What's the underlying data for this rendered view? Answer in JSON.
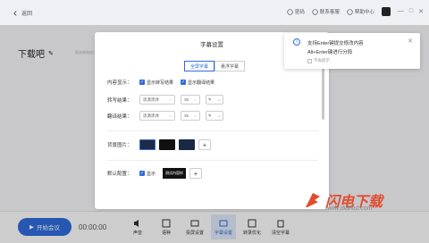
{
  "header": {
    "back_label": "返回",
    "items": [
      {
        "label": "密码",
        "icon": "lock-icon"
      },
      {
        "label": "联系客服",
        "icon": "headset-icon"
      },
      {
        "label": "帮助中心",
        "icon": "help-icon"
      }
    ]
  },
  "main": {
    "title": "下载吧",
    "subtitle": "双击修改会议名称"
  },
  "dialog": {
    "title": "字幕设置",
    "tabs": [
      "全屏字幕",
      "悬浮字幕"
    ],
    "content_label": "内容显示：",
    "show_transcript": "显示转写结果",
    "show_translation": "显示翻译结果",
    "transcript_label": "转写结果：",
    "translation_label": "翻译结果：",
    "font": "思源黑体",
    "size": "35",
    "bg_label": "背景图片：",
    "default_label": "默认配置：",
    "show": "显示",
    "preview_text": "测试内容样"
  },
  "toast": {
    "line1": "支持Enter键提交修改内容",
    "line2": "Alt+Enter键进行分段",
    "checkbox": "不再提示"
  },
  "bottom": {
    "start": "开始会议",
    "timer": "00:00:00",
    "tools": [
      {
        "label": "声音",
        "icon": "speaker-icon"
      },
      {
        "label": "语种",
        "icon": "language-icon"
      },
      {
        "label": "投屏设置",
        "icon": "cast-icon"
      },
      {
        "label": "字幕设置",
        "icon": "subtitle-icon"
      },
      {
        "label": "转录优化",
        "icon": "optimize-icon"
      },
      {
        "label": "清空字幕",
        "icon": "clear-icon"
      }
    ]
  },
  "watermark": {
    "text": "闪电下载",
    "url": "www.dianlut.com"
  }
}
